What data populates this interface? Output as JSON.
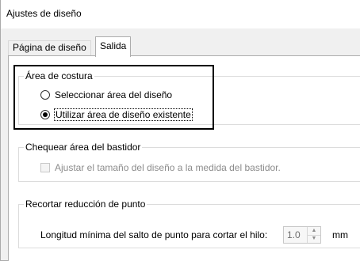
{
  "window": {
    "title": "Ajustes de diseño"
  },
  "tabs": [
    {
      "label": "Página de diseño",
      "active": false
    },
    {
      "label": "Salida",
      "active": true
    }
  ],
  "area_costura": {
    "legend": "Área de costura",
    "options": [
      {
        "label": "Seleccionar área del diseño",
        "checked": false
      },
      {
        "label": "Utilizar área de diseño existente",
        "checked": true
      }
    ]
  },
  "chequear": {
    "legend": "Chequear área del bastidor",
    "checkbox_label": "Ajustar el tamaño del diseño a la medida del bastidor.",
    "checked": false,
    "enabled": false
  },
  "recortar": {
    "legend": "Recortar reducción de punto",
    "field_label": "Longitud mínima del salto de punto para cortar el hilo:",
    "value": "1.0",
    "unit": "mm"
  }
}
